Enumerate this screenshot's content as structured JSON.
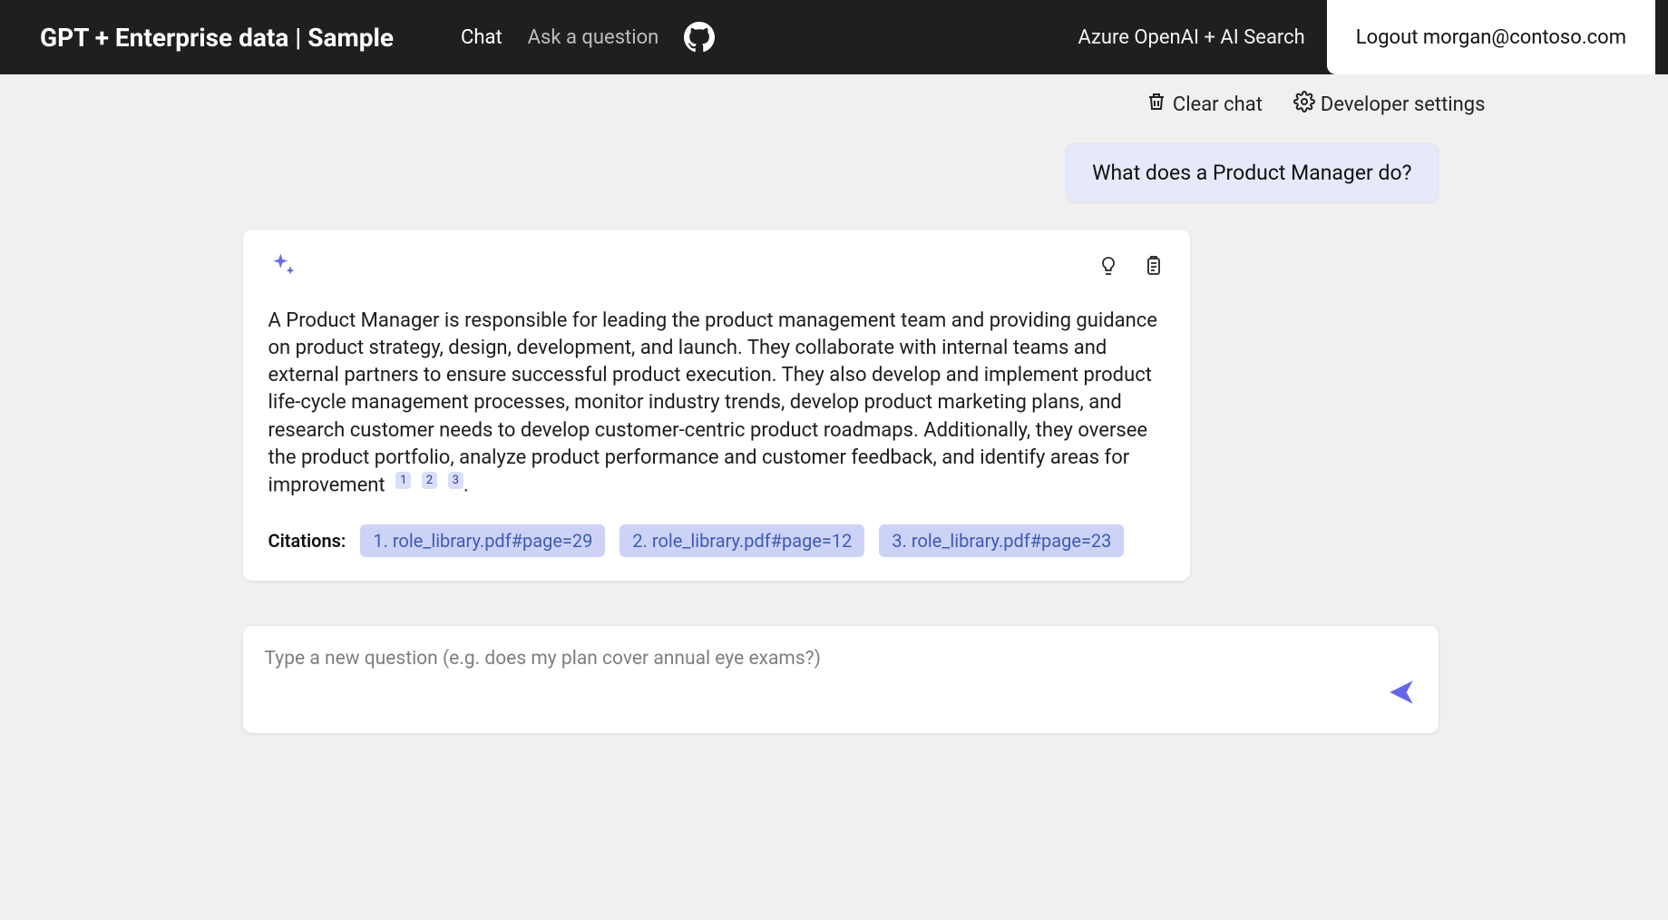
{
  "header": {
    "title": "GPT + Enterprise data | Sample",
    "nav": {
      "chat": "Chat",
      "ask": "Ask a question"
    },
    "subtitle": "Azure OpenAI + AI Search",
    "logout_label": "Logout morgan@contoso.com"
  },
  "toolbar": {
    "clear_chat": "Clear chat",
    "dev_settings": "Developer settings"
  },
  "chat": {
    "user_msg": "What does a Product Manager do?",
    "assistant_body": "A Product Manager is responsible for leading the product management team and providing guidance on product strategy, design, development, and launch. They collaborate with internal teams and external partners to ensure successful product execution. They also develop and implement product life-cycle management processes, monitor industry trends, develop product marketing plans, and research customer needs to develop customer-centric product roadmaps. Additionally, they oversee the product portfolio, analyze product performance and customer feedback, and identify areas for improvement",
    "refs": {
      "r1": "1",
      "r2": "2",
      "r3": "3"
    },
    "citations_label": "Citations:",
    "citations": [
      "1. role_library.pdf#page=29",
      "2. role_library.pdf#page=12",
      "3. role_library.pdf#page=23"
    ]
  },
  "input": {
    "placeholder": "Type a new question (e.g. does my plan cover annual eye exams?)"
  }
}
